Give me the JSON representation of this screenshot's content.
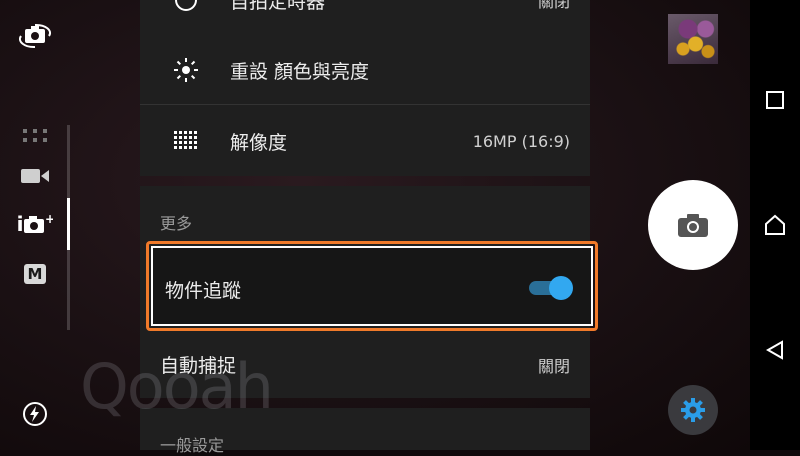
{
  "left_rail": {
    "items": [
      {
        "name": "switch-camera-icon"
      },
      {
        "name": "more-modes-icon"
      },
      {
        "name": "video-icon"
      },
      {
        "name": "superior-auto-icon",
        "label": "i"
      },
      {
        "name": "manual-mode-icon",
        "label": "M"
      },
      {
        "name": "flash-auto-icon"
      }
    ]
  },
  "menu": {
    "rows": [
      {
        "label": "自拍定時器",
        "value": "關閉",
        "icon": "self-timer-icon"
      },
      {
        "label": "重設 顏色與亮度",
        "value": "",
        "icon": "brightness-icon"
      },
      {
        "label": "解像度",
        "value": "16MP (16:9)",
        "icon": "resolution-grid-icon"
      }
    ],
    "section_more": "更多",
    "object_tracking": {
      "label": "物件追蹤",
      "enabled": true
    },
    "auto_capture": {
      "label": "自動捕捉",
      "value": "關閉"
    },
    "section_general": "一般設定"
  },
  "colors": {
    "accent": "#32a8f0",
    "highlight_border": "#f07a2a"
  },
  "watermark": "Qooah"
}
